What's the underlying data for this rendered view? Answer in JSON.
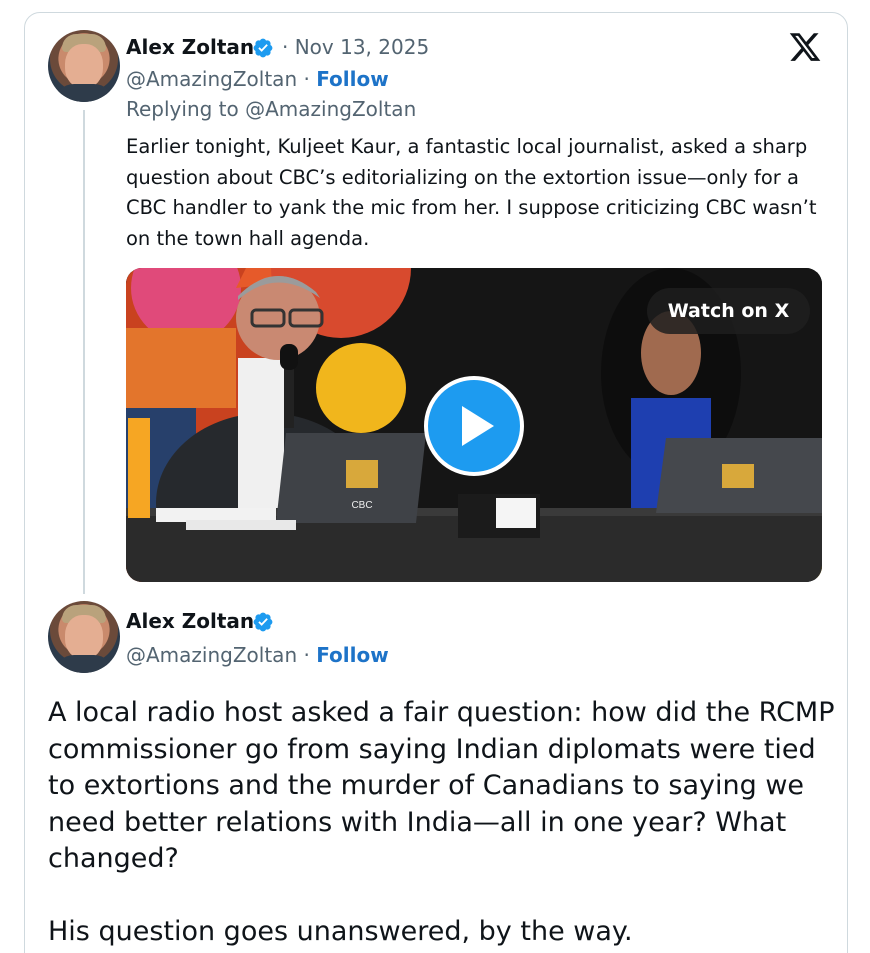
{
  "tweet1": {
    "author": "Alex Zoltan",
    "date_sep": "·",
    "date": "Nov 13, 2025",
    "handle": "@AmazingZoltan",
    "follow_sep": "·",
    "follow_label": "Follow",
    "replying_prefix": "Replying to",
    "replying_to": "@AmazingZoltan",
    "text": "Earlier tonight, Kuljeet Kaur, a fantastic local journalist, asked a sharp question about CBC’s editorializing on the extortion issue—only for a CBC handler to yank the mic from her. I suppose criticizing CBC wasn’t on the town hall agenda.",
    "video": {
      "watch_label": "Watch on X",
      "laptop_logo": "CBC"
    }
  },
  "tweet2": {
    "author": "Alex Zoltan",
    "handle": "@AmazingZoltan",
    "follow_sep": "·",
    "follow_label": "Follow",
    "paragraph1": "A local radio host asked a fair question: how did the RCMP commissioner go from saying Indian diplomats were tied to extortions and the murder of Canadians to saying we need better relations with India—all in one year? What changed?",
    "paragraph2": "His question goes unanswered, by the way."
  },
  "icons": {
    "platform_logo": "x-logo-icon",
    "verified": "verified-badge-icon",
    "play": "play-icon"
  },
  "colors": {
    "link_blue": "#1d73c8",
    "verified_blue": "#1d9bf0",
    "muted_text": "#536471",
    "border": "#cfd9de"
  }
}
